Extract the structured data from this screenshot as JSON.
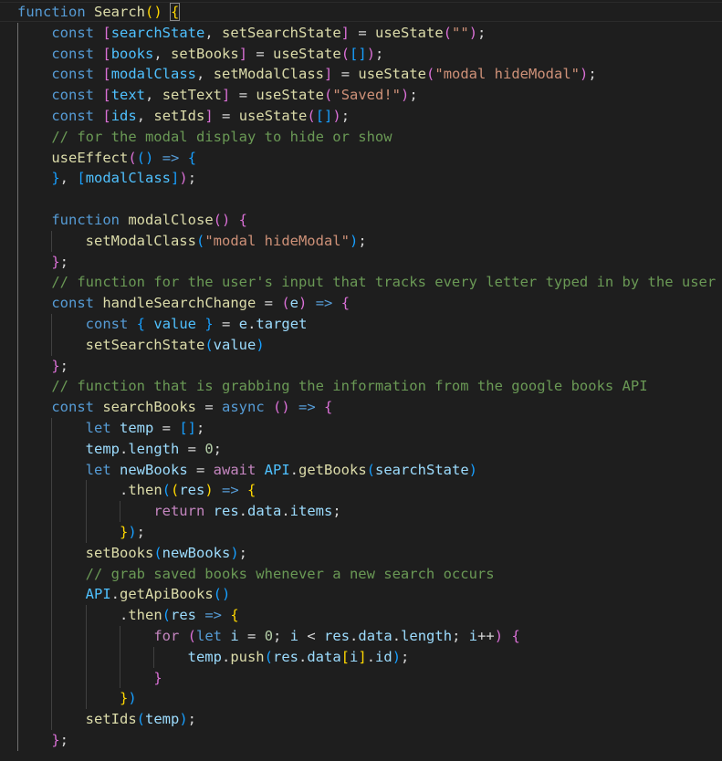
{
  "colors": {
    "background": "#1e1e1e",
    "keyword": "#569cd6",
    "control_keyword": "#c586c0",
    "function": "#dcdcaa",
    "variable": "#9cdcfe",
    "constant": "#4fc1ff",
    "string": "#ce9178",
    "number": "#b5cea8",
    "comment": "#6a9955",
    "punctuation": "#d4d4d4",
    "bracket_level_1": "#ffd700",
    "bracket_level_2": "#da70d6",
    "bracket_level_3": "#179fff"
  },
  "lines": [
    {
      "tokens": [
        [
          "function",
          "kw"
        ],
        [
          " ",
          "pl"
        ],
        [
          "Search",
          "fn"
        ],
        [
          "()",
          "b1"
        ],
        [
          " ",
          "pl"
        ],
        [
          "{",
          "b1"
        ]
      ]
    },
    {
      "tokens": [
        [
          "    ",
          "pl"
        ],
        [
          "const",
          "kw"
        ],
        [
          " ",
          "pl"
        ],
        [
          "[",
          "b2"
        ],
        [
          "searchState",
          "const"
        ],
        [
          ", ",
          "pl"
        ],
        [
          "setSearchState",
          "fn"
        ],
        [
          "]",
          "b2"
        ],
        [
          " = ",
          "pl"
        ],
        [
          "useState",
          "fn"
        ],
        [
          "(",
          "b2"
        ],
        [
          "\"\"",
          "str"
        ],
        [
          ")",
          "b2"
        ],
        [
          ";",
          "pl"
        ]
      ]
    },
    {
      "tokens": [
        [
          "    ",
          "pl"
        ],
        [
          "const",
          "kw"
        ],
        [
          " ",
          "pl"
        ],
        [
          "[",
          "b2"
        ],
        [
          "books",
          "const"
        ],
        [
          ", ",
          "pl"
        ],
        [
          "setBooks",
          "fn"
        ],
        [
          "]",
          "b2"
        ],
        [
          " = ",
          "pl"
        ],
        [
          "useState",
          "fn"
        ],
        [
          "(",
          "b2"
        ],
        [
          "[]",
          "b3"
        ],
        [
          ")",
          "b2"
        ],
        [
          ";",
          "pl"
        ]
      ]
    },
    {
      "tokens": [
        [
          "    ",
          "pl"
        ],
        [
          "const",
          "kw"
        ],
        [
          " ",
          "pl"
        ],
        [
          "[",
          "b2"
        ],
        [
          "modalClass",
          "const"
        ],
        [
          ", ",
          "pl"
        ],
        [
          "setModalClass",
          "fn"
        ],
        [
          "]",
          "b2"
        ],
        [
          " = ",
          "pl"
        ],
        [
          "useState",
          "fn"
        ],
        [
          "(",
          "b2"
        ],
        [
          "\"modal hideModal\"",
          "str"
        ],
        [
          ")",
          "b2"
        ],
        [
          ";",
          "pl"
        ]
      ]
    },
    {
      "tokens": [
        [
          "    ",
          "pl"
        ],
        [
          "const",
          "kw"
        ],
        [
          " ",
          "pl"
        ],
        [
          "[",
          "b2"
        ],
        [
          "text",
          "const"
        ],
        [
          ", ",
          "pl"
        ],
        [
          "setText",
          "fn"
        ],
        [
          "]",
          "b2"
        ],
        [
          " = ",
          "pl"
        ],
        [
          "useState",
          "fn"
        ],
        [
          "(",
          "b2"
        ],
        [
          "\"Saved!\"",
          "str"
        ],
        [
          ")",
          "b2"
        ],
        [
          ";",
          "pl"
        ]
      ]
    },
    {
      "tokens": [
        [
          "    ",
          "pl"
        ],
        [
          "const",
          "kw"
        ],
        [
          " ",
          "pl"
        ],
        [
          "[",
          "b2"
        ],
        [
          "ids",
          "const"
        ],
        [
          ", ",
          "pl"
        ],
        [
          "setIds",
          "fn"
        ],
        [
          "]",
          "b2"
        ],
        [
          " = ",
          "pl"
        ],
        [
          "useState",
          "fn"
        ],
        [
          "(",
          "b2"
        ],
        [
          "[]",
          "b3"
        ],
        [
          ")",
          "b2"
        ],
        [
          ";",
          "pl"
        ]
      ]
    },
    {
      "tokens": [
        [
          "    ",
          "pl"
        ],
        [
          "// for the modal display to hide or show",
          "cm"
        ]
      ]
    },
    {
      "tokens": [
        [
          "    ",
          "pl"
        ],
        [
          "useEffect",
          "fn"
        ],
        [
          "(",
          "b2"
        ],
        [
          "()",
          "b3"
        ],
        [
          " ",
          "pl"
        ],
        [
          "=>",
          "kw"
        ],
        [
          " ",
          "pl"
        ],
        [
          "{",
          "b3"
        ]
      ]
    },
    {
      "tokens": [
        [
          "    ",
          "pl"
        ],
        [
          "}",
          "b3"
        ],
        [
          ", ",
          "pl"
        ],
        [
          "[",
          "b3"
        ],
        [
          "modalClass",
          "const"
        ],
        [
          "]",
          "b3"
        ],
        [
          ")",
          "b2"
        ],
        [
          ";",
          "pl"
        ]
      ]
    },
    {
      "tokens": [
        [
          "",
          "pl"
        ]
      ]
    },
    {
      "tokens": [
        [
          "    ",
          "pl"
        ],
        [
          "function",
          "kw"
        ],
        [
          " ",
          "pl"
        ],
        [
          "modalClose",
          "fn"
        ],
        [
          "()",
          "b2"
        ],
        [
          " ",
          "pl"
        ],
        [
          "{",
          "b2"
        ]
      ]
    },
    {
      "tokens": [
        [
          "        ",
          "pl"
        ],
        [
          "setModalClass",
          "fn"
        ],
        [
          "(",
          "b3"
        ],
        [
          "\"modal hideModal\"",
          "str"
        ],
        [
          ")",
          "b3"
        ],
        [
          ";",
          "pl"
        ]
      ]
    },
    {
      "tokens": [
        [
          "    ",
          "pl"
        ],
        [
          "}",
          "b2"
        ],
        [
          ";",
          "pl"
        ]
      ]
    },
    {
      "tokens": [
        [
          "    ",
          "pl"
        ],
        [
          "// function for the user's input that tracks every letter typed in by the user",
          "cm"
        ]
      ]
    },
    {
      "tokens": [
        [
          "    ",
          "pl"
        ],
        [
          "const",
          "kw"
        ],
        [
          " ",
          "pl"
        ],
        [
          "handleSearchChange",
          "fn"
        ],
        [
          " = ",
          "pl"
        ],
        [
          "(",
          "b2"
        ],
        [
          "e",
          "var"
        ],
        [
          ")",
          "b2"
        ],
        [
          " ",
          "pl"
        ],
        [
          "=>",
          "kw"
        ],
        [
          " ",
          "pl"
        ],
        [
          "{",
          "b2"
        ]
      ]
    },
    {
      "tokens": [
        [
          "        ",
          "pl"
        ],
        [
          "const",
          "kw"
        ],
        [
          " ",
          "pl"
        ],
        [
          "{",
          "b3"
        ],
        [
          " ",
          "pl"
        ],
        [
          "value",
          "const"
        ],
        [
          " ",
          "pl"
        ],
        [
          "}",
          "b3"
        ],
        [
          " = ",
          "pl"
        ],
        [
          "e",
          "var"
        ],
        [
          ".",
          "pl"
        ],
        [
          "target",
          "var"
        ]
      ]
    },
    {
      "tokens": [
        [
          "        ",
          "pl"
        ],
        [
          "setSearchState",
          "fn"
        ],
        [
          "(",
          "b3"
        ],
        [
          "value",
          "var"
        ],
        [
          ")",
          "b3"
        ]
      ]
    },
    {
      "tokens": [
        [
          "    ",
          "pl"
        ],
        [
          "}",
          "b2"
        ],
        [
          ";",
          "pl"
        ]
      ]
    },
    {
      "tokens": [
        [
          "    ",
          "pl"
        ],
        [
          "// function that is grabbing the information from the google books API",
          "cm"
        ]
      ]
    },
    {
      "tokens": [
        [
          "    ",
          "pl"
        ],
        [
          "const",
          "kw"
        ],
        [
          " ",
          "pl"
        ],
        [
          "searchBooks",
          "fn"
        ],
        [
          " = ",
          "pl"
        ],
        [
          "async",
          "kw"
        ],
        [
          " ",
          "pl"
        ],
        [
          "()",
          "b2"
        ],
        [
          " ",
          "pl"
        ],
        [
          "=>",
          "kw"
        ],
        [
          " ",
          "pl"
        ],
        [
          "{",
          "b2"
        ]
      ]
    },
    {
      "tokens": [
        [
          "        ",
          "pl"
        ],
        [
          "let",
          "kw"
        ],
        [
          " ",
          "pl"
        ],
        [
          "temp",
          "var"
        ],
        [
          " = ",
          "pl"
        ],
        [
          "[]",
          "b3"
        ],
        [
          ";",
          "pl"
        ]
      ]
    },
    {
      "tokens": [
        [
          "        ",
          "pl"
        ],
        [
          "temp",
          "var"
        ],
        [
          ".",
          "pl"
        ],
        [
          "length",
          "var"
        ],
        [
          " = ",
          "pl"
        ],
        [
          "0",
          "num"
        ],
        [
          ";",
          "pl"
        ]
      ]
    },
    {
      "tokens": [
        [
          "        ",
          "pl"
        ],
        [
          "let",
          "kw"
        ],
        [
          " ",
          "pl"
        ],
        [
          "newBooks",
          "var"
        ],
        [
          " = ",
          "pl"
        ],
        [
          "await",
          "ctl"
        ],
        [
          " ",
          "pl"
        ],
        [
          "API",
          "const"
        ],
        [
          ".",
          "pl"
        ],
        [
          "getBooks",
          "fn"
        ],
        [
          "(",
          "b3"
        ],
        [
          "searchState",
          "var"
        ],
        [
          ")",
          "b3"
        ]
      ]
    },
    {
      "tokens": [
        [
          "            ",
          "pl"
        ],
        [
          ".",
          "pl"
        ],
        [
          "then",
          "fn"
        ],
        [
          "(",
          "b3"
        ],
        [
          "(",
          "b1"
        ],
        [
          "res",
          "var"
        ],
        [
          ")",
          "b1"
        ],
        [
          " ",
          "pl"
        ],
        [
          "=>",
          "kw"
        ],
        [
          " ",
          "pl"
        ],
        [
          "{",
          "b1"
        ]
      ]
    },
    {
      "tokens": [
        [
          "                ",
          "pl"
        ],
        [
          "return",
          "ctl"
        ],
        [
          " ",
          "pl"
        ],
        [
          "res",
          "var"
        ],
        [
          ".",
          "pl"
        ],
        [
          "data",
          "var"
        ],
        [
          ".",
          "pl"
        ],
        [
          "items",
          "var"
        ],
        [
          ";",
          "pl"
        ]
      ]
    },
    {
      "tokens": [
        [
          "            ",
          "pl"
        ],
        [
          "}",
          "b1"
        ],
        [
          ")",
          "b3"
        ],
        [
          ";",
          "pl"
        ]
      ]
    },
    {
      "tokens": [
        [
          "        ",
          "pl"
        ],
        [
          "setBooks",
          "fn"
        ],
        [
          "(",
          "b3"
        ],
        [
          "newBooks",
          "var"
        ],
        [
          ")",
          "b3"
        ],
        [
          ";",
          "pl"
        ]
      ]
    },
    {
      "tokens": [
        [
          "        ",
          "pl"
        ],
        [
          "// grab saved books whenever a new search occurs",
          "cm"
        ]
      ]
    },
    {
      "tokens": [
        [
          "        ",
          "pl"
        ],
        [
          "API",
          "const"
        ],
        [
          ".",
          "pl"
        ],
        [
          "getApiBooks",
          "fn"
        ],
        [
          "()",
          "b3"
        ]
      ]
    },
    {
      "tokens": [
        [
          "            ",
          "pl"
        ],
        [
          ".",
          "pl"
        ],
        [
          "then",
          "fn"
        ],
        [
          "(",
          "b3"
        ],
        [
          "res",
          "var"
        ],
        [
          " ",
          "pl"
        ],
        [
          "=>",
          "kw"
        ],
        [
          " ",
          "pl"
        ],
        [
          "{",
          "b1"
        ]
      ]
    },
    {
      "tokens": [
        [
          "                ",
          "pl"
        ],
        [
          "for",
          "ctl"
        ],
        [
          " ",
          "pl"
        ],
        [
          "(",
          "b2"
        ],
        [
          "let",
          "kw"
        ],
        [
          " ",
          "pl"
        ],
        [
          "i",
          "var"
        ],
        [
          " = ",
          "pl"
        ],
        [
          "0",
          "num"
        ],
        [
          "; ",
          "pl"
        ],
        [
          "i",
          "var"
        ],
        [
          " < ",
          "pl"
        ],
        [
          "res",
          "var"
        ],
        [
          ".",
          "pl"
        ],
        [
          "data",
          "var"
        ],
        [
          ".",
          "pl"
        ],
        [
          "length",
          "var"
        ],
        [
          "; ",
          "pl"
        ],
        [
          "i",
          "var"
        ],
        [
          "++",
          "pl"
        ],
        [
          ")",
          "b2"
        ],
        [
          " ",
          "pl"
        ],
        [
          "{",
          "b2"
        ]
      ]
    },
    {
      "tokens": [
        [
          "                    ",
          "pl"
        ],
        [
          "temp",
          "var"
        ],
        [
          ".",
          "pl"
        ],
        [
          "push",
          "fn"
        ],
        [
          "(",
          "b3"
        ],
        [
          "res",
          "var"
        ],
        [
          ".",
          "pl"
        ],
        [
          "data",
          "var"
        ],
        [
          "[",
          "b1"
        ],
        [
          "i",
          "var"
        ],
        [
          "]",
          "b1"
        ],
        [
          ".",
          "pl"
        ],
        [
          "id",
          "var"
        ],
        [
          ")",
          "b3"
        ],
        [
          ";",
          "pl"
        ]
      ]
    },
    {
      "tokens": [
        [
          "                ",
          "pl"
        ],
        [
          "}",
          "b2"
        ]
      ]
    },
    {
      "tokens": [
        [
          "            ",
          "pl"
        ],
        [
          "}",
          "b1"
        ],
        [
          ")",
          "b3"
        ]
      ]
    },
    {
      "tokens": [
        [
          "        ",
          "pl"
        ],
        [
          "setIds",
          "fn"
        ],
        [
          "(",
          "b3"
        ],
        [
          "temp",
          "var"
        ],
        [
          ")",
          "b3"
        ],
        [
          ";",
          "pl"
        ]
      ]
    },
    {
      "tokens": [
        [
          "    ",
          "pl"
        ],
        [
          "}",
          "b2"
        ],
        [
          ";",
          "pl"
        ]
      ]
    }
  ]
}
